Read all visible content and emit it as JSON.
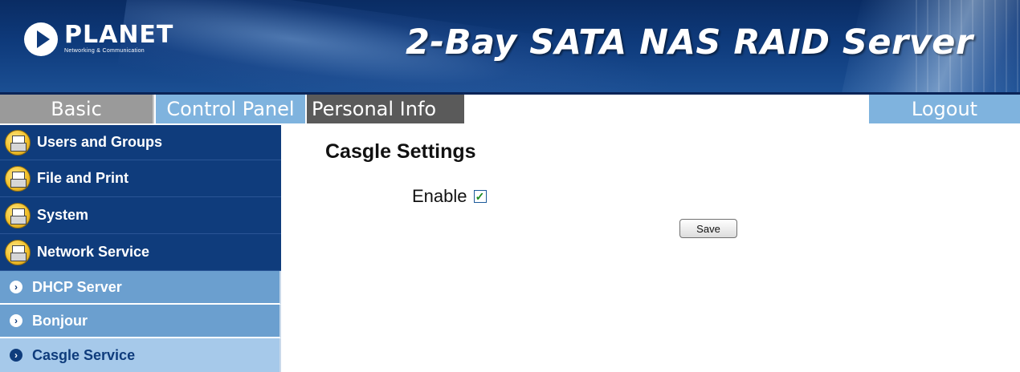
{
  "banner": {
    "logo_brand": "PLANET",
    "logo_tagline": "Networking & Communication",
    "title": "2-Bay SATA NAS RAID Server"
  },
  "tabs": {
    "basic": "Basic",
    "control_panel": "Control Panel",
    "personal_info": "Personal Info",
    "logout": "Logout"
  },
  "sidebar": {
    "categories": [
      {
        "label": "Users and Groups",
        "icon": "printer-icon"
      },
      {
        "label": "File and Print",
        "icon": "printer-icon"
      },
      {
        "label": "System",
        "icon": "printer-icon"
      },
      {
        "label": "Network Service",
        "icon": "printer-icon"
      }
    ],
    "subitems": [
      {
        "label": "DHCP Server",
        "icon": "chevron-right-icon"
      },
      {
        "label": "Bonjour",
        "icon": "chevron-right-icon"
      },
      {
        "label": "Casgle Service",
        "icon": "chevron-right-icon",
        "active": true
      }
    ]
  },
  "main": {
    "title": "Casgle Settings",
    "enable_label": "Enable",
    "enable_checked": true,
    "save_label": "Save"
  },
  "colors": {
    "banner": "#0e3a7b",
    "tab_active": "#7fb3de",
    "tab_basic": "#9a9a9a",
    "tab_personal": "#5a5a5a",
    "sidebar_dark": "#0f3c7c",
    "sidebar_sub": "#6b9fcf",
    "sidebar_active": "#a6c9ea"
  }
}
